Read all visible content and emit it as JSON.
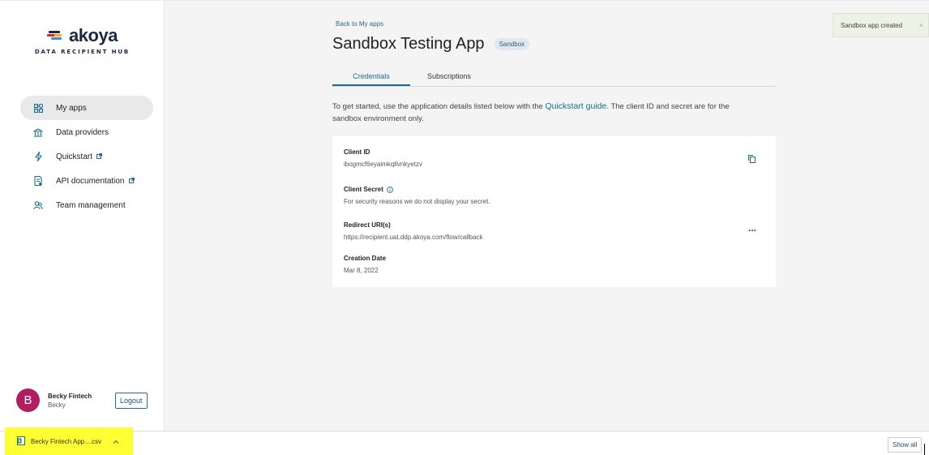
{
  "brand": {
    "name": "akoya",
    "subtitle": "DATA RECIPIENT HUB",
    "colors": [
      "#d32a3a",
      "#f5a623",
      "#3d8dd9",
      "#1b2a44"
    ]
  },
  "sidebar": {
    "items": [
      {
        "label": "My apps",
        "icon": "apps-icon",
        "active": true
      },
      {
        "label": "Data providers",
        "icon": "bank-icon",
        "active": false
      },
      {
        "label": "Quickstart",
        "icon": "lightning-icon",
        "external": true
      },
      {
        "label": "API documentation",
        "icon": "document-icon",
        "external": true
      },
      {
        "label": "Team management",
        "icon": "team-icon",
        "active": false
      }
    ],
    "user": {
      "initial": "B",
      "name": "Becky Fintech",
      "org": "Becky",
      "logout_label": "Logout"
    }
  },
  "main": {
    "back_link": "Back to My apps",
    "title": "Sandbox Testing App",
    "badge": "Sandbox",
    "tabs": [
      {
        "label": "Credentials",
        "active": true
      },
      {
        "label": "Subscriptions",
        "active": false
      }
    ],
    "intro": {
      "before": "To get started, use the application details listed below with the ",
      "link": "Quickstart guide",
      "after": ". The client ID and secret are for the sandbox environment only."
    },
    "card": {
      "client_id_label": "Client ID",
      "client_id_value": "ibogmcf6eyaimkqllvnkyetzv",
      "client_secret_label": "Client Secret",
      "client_secret_value": "For security reasons we do not display your secret.",
      "redirect_label": "Redirect URI(s)",
      "redirect_value": "https://recipient.uat.ddp.akoya.com/flow/callback",
      "creation_label": "Creation Date",
      "creation_value": "Mar 8, 2022",
      "more_label": "..."
    }
  },
  "toast": {
    "message": "Sandbox app created",
    "close": "×"
  },
  "download_bar": {
    "file_name": "Becky Fintech App....csv",
    "show_all": "Show all",
    "highlight_color": "#ffff33"
  }
}
